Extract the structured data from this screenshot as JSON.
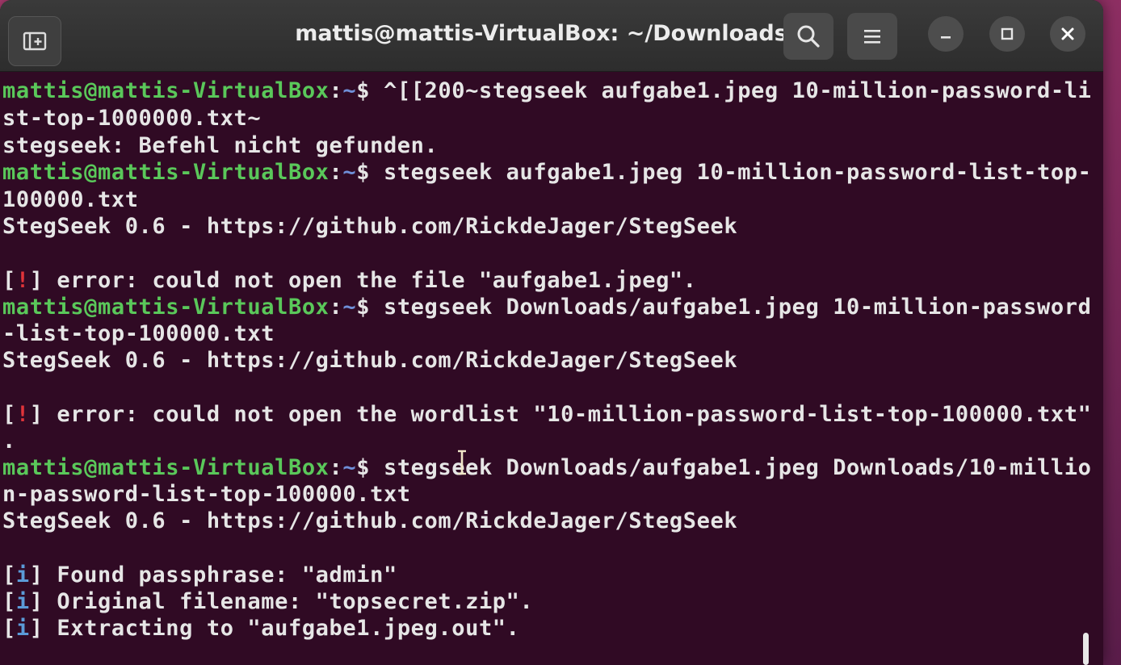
{
  "window": {
    "title": "mattis@mattis-VirtualBox: ~/Downloads"
  },
  "titlebar": {
    "icons": [
      "new-tab-icon",
      "search-icon",
      "hamburger-menu-icon",
      "minimize-icon",
      "maximize-icon",
      "close-icon"
    ]
  },
  "prompt": {
    "user_host": "mattis@mattis-VirtualBox",
    "sep": ":",
    "dir": "~",
    "symbol": "$"
  },
  "lines": {
    "l1_cmd": " ^[[200~stegseek aufgabe1.jpeg 10-million-password-li",
    "l2": "st-top-1000000.txt~",
    "l3": "stegseek: Befehl nicht gefunden.",
    "l4_cmd": " stegseek aufgabe1.jpeg 10-million-password-list-top-",
    "l5": "100000.txt",
    "l6": "StegSeek 0.6 - https://github.com/RickdeJager/StegSeek",
    "l8_open": "[",
    "l8_mark": "!",
    "l8_rest": "] error: could not open the file \"aufgabe1.jpeg\".",
    "l9_cmd": " stegseek Downloads/aufgabe1.jpeg 10-million-password",
    "l10": "-list-top-100000.txt",
    "l11": "StegSeek 0.6 - https://github.com/RickdeJager/StegSeek",
    "l13_open": "[",
    "l13_mark": "!",
    "l13_rest": "] error: could not open the wordlist \"10-million-password-list-top-100000.txt\"",
    "l14": ".",
    "l15_cmd": " stegseek Downloads/aufgabe1.jpeg Downloads/10-millio",
    "l16": "n-password-list-top-100000.txt",
    "l17": "StegSeek 0.6 - https://github.com/RickdeJager/StegSeek",
    "l19_open": "[",
    "l19_mark": "i",
    "l19_rest": "] Found passphrase: \"admin\"",
    "l20_open": "[",
    "l20_mark": "i",
    "l20_rest": "] Original filename: \"topsecret.zip\".",
    "l21_open": "[",
    "l21_mark": "i",
    "l21_rest": "] Extracting to \"aufgabe1.jpeg.out\"."
  },
  "colors": {
    "terminal_bg": "#300a24",
    "prompt_user": "#5ac85a",
    "prompt_path": "#6f8fd8",
    "error_mark": "#e0343a",
    "info_mark": "#5b9bd8",
    "text": "#e6e6e6"
  }
}
